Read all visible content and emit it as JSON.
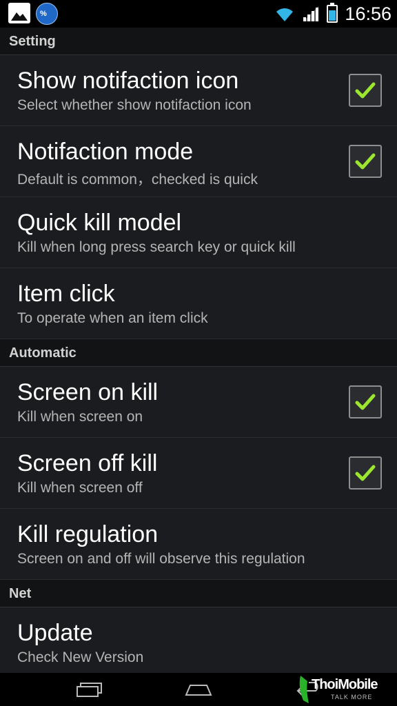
{
  "status_bar": {
    "time": "16:56",
    "notification_icons": [
      "gallery-icon",
      "app-percent-icon"
    ],
    "app_icon_text": "%",
    "system_icons": [
      "wifi-icon",
      "signal-icon",
      "battery-icon"
    ],
    "battery_level": 0.7
  },
  "sections": [
    {
      "header": "Setting",
      "items": [
        {
          "title": "Show notifaction icon",
          "summary": "Select whether show notifaction icon",
          "checkbox": true,
          "checked": true
        },
        {
          "title": "Notifaction mode",
          "summary": "Default is common，checked is quick",
          "checkbox": true,
          "checked": true
        },
        {
          "title": "Quick kill model",
          "summary": "Kill when long press search key or quick kill",
          "checkbox": false
        },
        {
          "title": "Item click",
          "summary": "To operate when an item click",
          "checkbox": false
        }
      ]
    },
    {
      "header": "Automatic",
      "items": [
        {
          "title": "Screen on kill",
          "summary": "Kill when screen on",
          "checkbox": true,
          "checked": true
        },
        {
          "title": "Screen off kill",
          "summary": "Kill when screen off",
          "checkbox": true,
          "checked": true
        },
        {
          "title": "Kill regulation",
          "summary": "Screen on and off will observe this regulation",
          "checkbox": false
        }
      ]
    },
    {
      "header": "Net",
      "items": [
        {
          "title": "Update",
          "summary": "Check New Version",
          "checkbox": false
        }
      ]
    }
  ],
  "nav_bar": {
    "buttons": [
      "recent-apps-icon",
      "home-icon",
      "back-icon"
    ]
  },
  "watermark": {
    "name": "ThoiMobile",
    "tagline": "TALK MORE"
  },
  "colors": {
    "check": "#9ce62f",
    "item_bg": "#1b1c1f",
    "header_bg": "#121314",
    "accent": "#33b5e5"
  }
}
